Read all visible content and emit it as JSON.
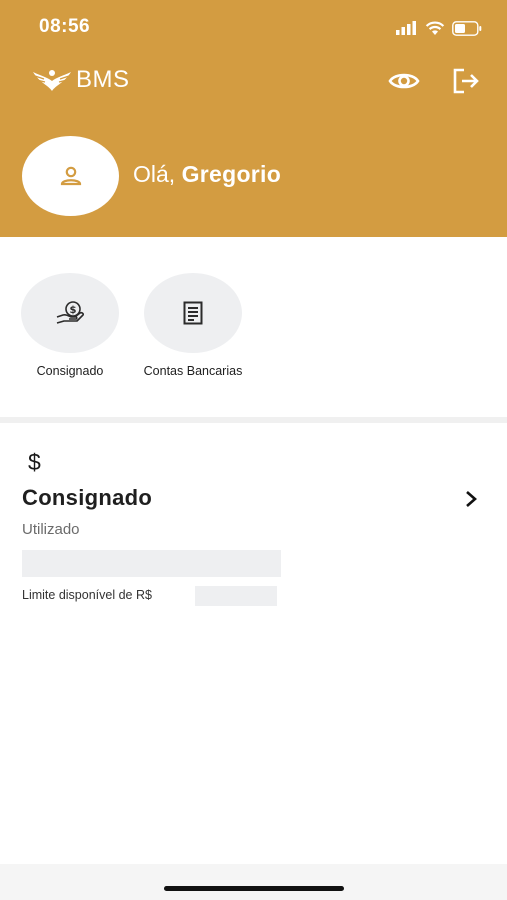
{
  "status_bar": {
    "time": "08:56"
  },
  "header": {
    "brand": "BMS",
    "greeting_prefix": "Olá, ",
    "user_name": "Gregorio",
    "icons": {
      "avatar": "person-icon",
      "visibility": "eye-icon",
      "logout": "logout-icon"
    },
    "accent_color": "#d39c41"
  },
  "shortcuts": [
    {
      "label": "Consignado",
      "icon": "hand-coin-icon"
    },
    {
      "label": "Contas Bancarias",
      "icon": "statement-icon"
    }
  ],
  "card": {
    "currency_symbol": "$",
    "title": "Consignado",
    "used_label": "Utilizado",
    "limit_label": "Limite disponível de R$"
  }
}
